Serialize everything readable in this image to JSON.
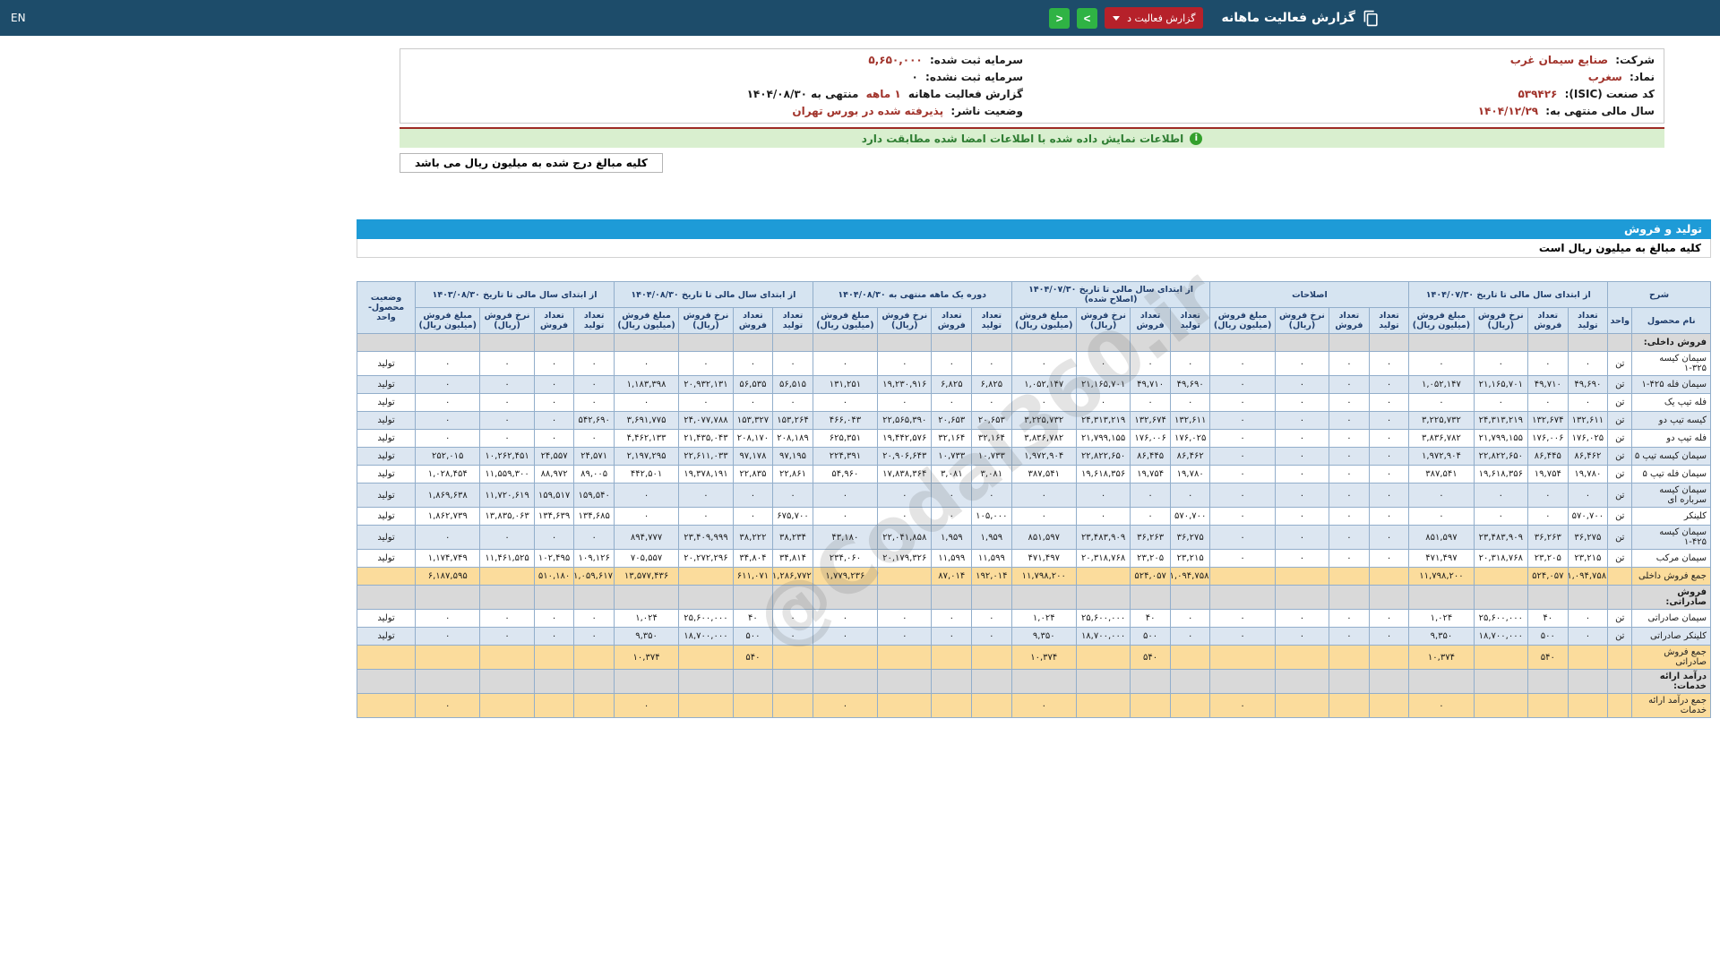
{
  "navbar": {
    "title": "گزارش فعالیت ماهانه",
    "dropdown_label": "گزارش فعالیت د",
    "forward_label": ">",
    "back_label": "<",
    "lang": "EN"
  },
  "company_info": {
    "rows": [
      {
        "label": "شرکت:",
        "value": "صنایع سیمان غرب",
        "extra": ""
      },
      {
        "label": "سرمایه ثبت شده:",
        "value": "۵,۶۵۰,۰۰۰",
        "extra": ""
      },
      {
        "label": "نماد:",
        "value": "سغرب",
        "extra": ""
      },
      {
        "label": "سرمایه ثبت نشده:",
        "value": "۰",
        "extra": ""
      },
      {
        "label": "کد صنعت (ISIC):",
        "value": "۵۳۹۴۲۶",
        "extra": ""
      },
      {
        "label": "گزارش فعالیت ماهانه",
        "value": "۱ ماهه",
        "extra": "منتهی به ۱۴۰۴/۰۸/۳۰"
      },
      {
        "label": "سال مالی منتهی به:",
        "value": "۱۴۰۴/۱۲/۲۹",
        "extra": ""
      },
      {
        "label": "وضعیت ناشر:",
        "value": "پذیرفته شده در بورس تهران",
        "extra": ""
      }
    ]
  },
  "notice": "اطلاعات نمایش داده شده با اطلاعات امضا شده مطابقت دارد",
  "unit_tab": "کلیه مبالغ درج شده به میلیون ریال می باشد",
  "section_title": "تولید و فروش",
  "table_note": "کلیه مبالغ به میلیون ریال است",
  "watermark": "@Codal360.ir",
  "table": {
    "desc_header": "شرح",
    "name_header": "نام محصول",
    "unit_header": "واحد",
    "status_header": "وضعیت محصول-واحد",
    "col_groups": [
      "از ابتدای سال مالی تا تاریخ ۱۴۰۴/۰۷/۳۰",
      "اصلاحات",
      "از ابتدای سال مالی تا تاریخ ۱۴۰۴/۰۷/۳۰ (اصلاح شده)",
      "دوره یک ماهه منتهی به ۱۴۰۴/۰۸/۳۰",
      "از ابتدای سال مالی تا تاریخ ۱۴۰۴/۰۸/۳۰",
      "از ابتدای سال مالی تا تاریخ ۱۴۰۳/۰۸/۳۰"
    ],
    "sub_cols": [
      "تعداد تولید",
      "تعداد فروش",
      "نرخ فروش (ریال)",
      "مبلغ فروش (میلیون ریال)"
    ],
    "rows": [
      {
        "type": "section",
        "name": "فروش داخلی:"
      },
      {
        "type": "data",
        "name": "سیمان کیسه ۳۲۵-۱",
        "unit": "تن",
        "status": "تولید",
        "cells": [
          "۰",
          "۰",
          "۰",
          "۰",
          "۰",
          "۰",
          "۰",
          "۰",
          "۰",
          "۰",
          "۰",
          "۰",
          "۰",
          "۰",
          "۰",
          "۰",
          "۰",
          "۰",
          "۰",
          "۰",
          "۰",
          "۰",
          "۰",
          "۰"
        ]
      },
      {
        "type": "data",
        "name": "سیمان فله ۴۲۵-۱",
        "unit": "تن",
        "status": "تولید",
        "cells": [
          "۴۹,۶۹۰",
          "۴۹,۷۱۰",
          "۲۱,۱۶۵,۷۰۱",
          "۱,۰۵۲,۱۴۷",
          "۰",
          "۰",
          "۰",
          "۰",
          "۴۹,۶۹۰",
          "۴۹,۷۱۰",
          "۲۱,۱۶۵,۷۰۱",
          "۱,۰۵۲,۱۴۷",
          "۶,۸۲۵",
          "۶,۸۲۵",
          "۱۹,۲۳۰,۹۱۶",
          "۱۳۱,۲۵۱",
          "۵۶,۵۱۵",
          "۵۶,۵۳۵",
          "۲۰,۹۳۲,۱۳۱",
          "۱,۱۸۳,۳۹۸",
          "۰",
          "۰",
          "۰",
          "۰"
        ]
      },
      {
        "type": "data",
        "name": "فله تیپ یک",
        "unit": "تن",
        "status": "تولید",
        "cells": [
          "۰",
          "۰",
          "۰",
          "۰",
          "۰",
          "۰",
          "۰",
          "۰",
          "۰",
          "۰",
          "۰",
          "۰",
          "۰",
          "۰",
          "۰",
          "۰",
          "۰",
          "۰",
          "۰",
          "۰",
          "۰",
          "۰",
          "۰",
          "۰"
        ]
      },
      {
        "type": "data",
        "name": "کیسه تیپ دو",
        "unit": "تن",
        "status": "تولید",
        "cells": [
          "۱۳۲,۶۱۱",
          "۱۳۲,۶۷۴",
          "۲۴,۳۱۳,۲۱۹",
          "۳,۲۲۵,۷۳۲",
          "۰",
          "۰",
          "۰",
          "۰",
          "۱۳۲,۶۱۱",
          "۱۳۲,۶۷۴",
          "۲۴,۳۱۳,۲۱۹",
          "۳,۲۲۵,۷۳۲",
          "۲۰,۶۵۳",
          "۲۰,۶۵۳",
          "۲۲,۵۶۵,۳۹۰",
          "۴۶۶,۰۴۳",
          "۱۵۳,۲۶۴",
          "۱۵۳,۳۲۷",
          "۲۴,۰۷۷,۷۸۸",
          "۳,۶۹۱,۷۷۵",
          "۵۴۲,۶۹۰",
          "۰",
          "۰",
          "۰"
        ]
      },
      {
        "type": "data",
        "name": "فله تیپ دو",
        "unit": "تن",
        "status": "تولید",
        "cells": [
          "۱۷۶,۰۲۵",
          "۱۷۶,۰۰۶",
          "۲۱,۷۹۹,۱۵۵",
          "۳,۸۳۶,۷۸۲",
          "۰",
          "۰",
          "۰",
          "۰",
          "۱۷۶,۰۲۵",
          "۱۷۶,۰۰۶",
          "۲۱,۷۹۹,۱۵۵",
          "۳,۸۳۶,۷۸۲",
          "۳۲,۱۶۴",
          "۳۲,۱۶۴",
          "۱۹,۴۴۲,۵۷۶",
          "۶۲۵,۳۵۱",
          "۲۰۸,۱۸۹",
          "۲۰۸,۱۷۰",
          "۲۱,۴۳۵,۰۴۳",
          "۴,۴۶۲,۱۳۳",
          "۰",
          "۰",
          "۰",
          "۰"
        ]
      },
      {
        "type": "data",
        "name": "سیمان کیسه تیپ ۵",
        "unit": "تن",
        "status": "تولید",
        "cells": [
          "۸۶,۴۶۲",
          "۸۶,۴۴۵",
          "۲۲,۸۲۲,۶۵۰",
          "۱,۹۷۲,۹۰۴",
          "۰",
          "۰",
          "۰",
          "۰",
          "۸۶,۴۶۲",
          "۸۶,۴۴۵",
          "۲۲,۸۲۲,۶۵۰",
          "۱,۹۷۲,۹۰۴",
          "۱۰,۷۳۳",
          "۱۰,۷۳۳",
          "۲۰,۹۰۶,۶۴۳",
          "۲۲۴,۳۹۱",
          "۹۷,۱۹۵",
          "۹۷,۱۷۸",
          "۲۲,۶۱۱,۰۳۳",
          "۲,۱۹۷,۲۹۵",
          "۲۴,۵۷۱",
          "۲۴,۵۵۷",
          "۱۰,۲۶۲,۴۵۱",
          "۲۵۲,۰۱۵"
        ]
      },
      {
        "type": "data",
        "name": "سیمان فله تیپ ۵",
        "unit": "تن",
        "status": "تولید",
        "cells": [
          "۱۹,۷۸۰",
          "۱۹,۷۵۴",
          "۱۹,۶۱۸,۳۵۶",
          "۳۸۷,۵۴۱",
          "۰",
          "۰",
          "۰",
          "۰",
          "۱۹,۷۸۰",
          "۱۹,۷۵۴",
          "۱۹,۶۱۸,۳۵۶",
          "۳۸۷,۵۴۱",
          "۳,۰۸۱",
          "۳,۰۸۱",
          "۱۷,۸۳۸,۳۶۴",
          "۵۴,۹۶۰",
          "۲۲,۸۶۱",
          "۲۲,۸۳۵",
          "۱۹,۳۷۸,۱۹۱",
          "۴۴۲,۵۰۱",
          "۸۹,۰۰۵",
          "۸۸,۹۷۲",
          "۱۱,۵۵۹,۳۰۰",
          "۱,۰۲۸,۴۵۴"
        ]
      },
      {
        "type": "data",
        "name": "سیمان کیسه سرباره ای",
        "unit": "تن",
        "status": "تولید",
        "cells": [
          "۰",
          "۰",
          "۰",
          "۰",
          "۰",
          "۰",
          "۰",
          "۰",
          "۰",
          "۰",
          "۰",
          "۰",
          "۰",
          "۰",
          "۰",
          "۰",
          "۰",
          "۰",
          "۰",
          "۰",
          "۱۵۹,۵۴۰",
          "۱۵۹,۵۱۷",
          "۱۱,۷۲۰,۶۱۹",
          "۱,۸۶۹,۶۳۸"
        ]
      },
      {
        "type": "data",
        "name": "کلینکر",
        "unit": "تن",
        "status": "تولید",
        "cells": [
          "۵۷۰,۷۰۰",
          "۰",
          "۰",
          "۰",
          "۰",
          "۰",
          "۰",
          "۰",
          "۵۷۰,۷۰۰",
          "۰",
          "۰",
          "۰",
          "۱۰۵,۰۰۰",
          "۰",
          "۰",
          "۰",
          "۶۷۵,۷۰۰",
          "۰",
          "۰",
          "۰",
          "۱۳۴,۶۸۵",
          "۱۳۴,۶۳۹",
          "۱۳,۸۳۵,۰۶۳",
          "۱,۸۶۲,۷۳۹"
        ]
      },
      {
        "type": "data",
        "name": "سیمان کیسه ۴۲۵-۱",
        "unit": "تن",
        "status": "تولید",
        "cells": [
          "۳۶,۲۷۵",
          "۳۶,۲۶۳",
          "۲۳,۴۸۳,۹۰۹",
          "۸۵۱,۵۹۷",
          "۰",
          "۰",
          "۰",
          "۰",
          "۳۶,۲۷۵",
          "۳۶,۲۶۳",
          "۲۳,۴۸۳,۹۰۹",
          "۸۵۱,۵۹۷",
          "۱,۹۵۹",
          "۱,۹۵۹",
          "۲۲,۰۴۱,۸۵۸",
          "۴۳,۱۸۰",
          "۳۸,۲۳۴",
          "۳۸,۲۲۲",
          "۲۳,۴۰۹,۹۹۹",
          "۸۹۴,۷۷۷",
          "۰",
          "۰",
          "۰",
          "۰"
        ]
      },
      {
        "type": "data",
        "name": "سیمان مرکب",
        "unit": "تن",
        "status": "تولید",
        "cells": [
          "۲۳,۲۱۵",
          "۲۳,۲۰۵",
          "۲۰,۳۱۸,۷۶۸",
          "۴۷۱,۴۹۷",
          "۰",
          "۰",
          "۰",
          "۰",
          "۲۳,۲۱۵",
          "۲۳,۲۰۵",
          "۲۰,۳۱۸,۷۶۸",
          "۴۷۱,۴۹۷",
          "۱۱,۵۹۹",
          "۱۱,۵۹۹",
          "۲۰,۱۷۹,۳۲۶",
          "۲۳۴,۰۶۰",
          "۳۴,۸۱۴",
          "۳۴,۸۰۴",
          "۲۰,۲۷۲,۲۹۶",
          "۷۰۵,۵۵۷",
          "۱۰۹,۱۲۶",
          "۱۰۲,۴۹۵",
          "۱۱,۴۶۱,۵۲۵",
          "۱,۱۷۴,۷۴۹"
        ]
      },
      {
        "type": "sum",
        "name": "جمع فروش داخلی",
        "unit": "",
        "status": "",
        "cells": [
          "۱,۰۹۴,۷۵۸",
          "۵۲۴,۰۵۷",
          "",
          "۱۱,۷۹۸,۲۰۰",
          "",
          "",
          "",
          "",
          "۱,۰۹۴,۷۵۸",
          "۵۲۴,۰۵۷",
          "",
          "۱۱,۷۹۸,۲۰۰",
          "۱۹۲,۰۱۴",
          "۸۷,۰۱۴",
          "",
          "۱,۷۷۹,۲۳۶",
          "۱,۲۸۶,۷۷۲",
          "۶۱۱,۰۷۱",
          "",
          "۱۳,۵۷۷,۴۳۶",
          "۱,۰۵۹,۶۱۷",
          "۵۱۰,۱۸۰",
          "",
          "۶,۱۸۷,۵۹۵"
        ]
      },
      {
        "type": "section",
        "name": "فروش صادراتی:"
      },
      {
        "type": "data",
        "name": "سیمان صادراتی",
        "unit": "تن",
        "status": "تولید",
        "cells": [
          "۰",
          "۴۰",
          "۲۵,۶۰۰,۰۰۰",
          "۱,۰۲۴",
          "۰",
          "۰",
          "۰",
          "۰",
          "۰",
          "۴۰",
          "۲۵,۶۰۰,۰۰۰",
          "۱,۰۲۴",
          "۰",
          "۰",
          "۰",
          "۰",
          "۰",
          "۴۰",
          "۲۵,۶۰۰,۰۰۰",
          "۱,۰۲۴",
          "۰",
          "۰",
          "۰",
          "۰"
        ]
      },
      {
        "type": "data",
        "name": "کلینکر صادراتی",
        "unit": "تن",
        "status": "تولید",
        "cells": [
          "۰",
          "۵۰۰",
          "۱۸,۷۰۰,۰۰۰",
          "۹,۳۵۰",
          "۰",
          "۰",
          "۰",
          "۰",
          "۰",
          "۵۰۰",
          "۱۸,۷۰۰,۰۰۰",
          "۹,۳۵۰",
          "۰",
          "۰",
          "۰",
          "۰",
          "۰",
          "۵۰۰",
          "۱۸,۷۰۰,۰۰۰",
          "۹,۳۵۰",
          "۰",
          "۰",
          "۰",
          "۰"
        ]
      },
      {
        "type": "sum",
        "name": "جمع فروش صادراتی",
        "unit": "",
        "status": "",
        "cells": [
          "",
          "۵۴۰",
          "",
          "۱۰,۳۷۴",
          "",
          "",
          "",
          "",
          "",
          "۵۴۰",
          "",
          "۱۰,۳۷۴",
          "",
          "",
          "",
          "",
          "",
          "۵۴۰",
          "",
          "۱۰,۳۷۴",
          "",
          "",
          "",
          ""
        ]
      },
      {
        "type": "section",
        "name": "درآمد ارائه خدمات:"
      },
      {
        "type": "sum",
        "name": "جمع درآمد ارائه خدمات",
        "unit": "",
        "status": "",
        "cells": [
          "",
          "",
          "",
          "۰",
          "",
          "",
          "",
          "۰",
          "",
          "",
          "",
          "۰",
          "",
          "",
          "",
          "۰",
          "",
          "",
          "",
          "۰",
          "",
          "",
          "",
          "۰"
        ]
      }
    ]
  }
}
